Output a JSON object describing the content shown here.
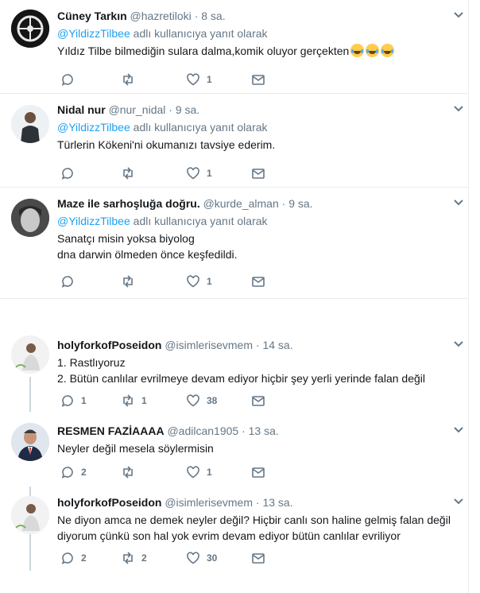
{
  "tweets": [
    {
      "name": "Cüney Tarkın",
      "handle": "@hazretiloki",
      "dot": "·",
      "time": "8 sa.",
      "reply_mention": "@YildizzTilbee",
      "reply_suffix": "adlı kullanıcıya yanıt olarak",
      "text": "Yıldız Tilbe bilmediğin sulara dalma,komik oluyor gerçekten",
      "emoji": [
        "face-with-tears-of-joy",
        "face-with-tears-of-joy",
        "face-with-tears-of-joy"
      ],
      "reply_count": "",
      "retweet_count": "",
      "like_count": "1"
    },
    {
      "name": "Nidal nur",
      "handle": "@nur_nidal",
      "dot": "·",
      "time": "9 sa.",
      "reply_mention": "@YildizzTilbee",
      "reply_suffix": "adlı kullanıcıya yanıt olarak",
      "text": "Türlerin Kökeni'ni okumanızı tavsiye ederim.",
      "reply_count": "",
      "retweet_count": "",
      "like_count": "1"
    },
    {
      "name": "Maze ile sarhoşluğa doğru.",
      "handle": "@kurde_alman",
      "dot": "·",
      "time": "9 sa.",
      "reply_mention": "@YildizzTilbee",
      "reply_suffix": "adlı kullanıcıya yanıt olarak",
      "text": "Sanatçı misin yoksa biyolog\ndna darwin  ölmeden önce keşfedildi.",
      "reply_count": "",
      "retweet_count": "",
      "like_count": "1"
    },
    {
      "name": "holyforkofPoseidon",
      "handle": "@isimlerisevmem",
      "dot": "·",
      "time": "14 sa.",
      "text": "1. Rastlıyoruz\n2. Bütün canlılar evrilmeye devam ediyor hiçbir şey yerli yerinde falan değil",
      "reply_count": "1",
      "retweet_count": "1",
      "like_count": "38"
    },
    {
      "name": "RESMEN FAZİAAAA",
      "handle": "@adilcan1905",
      "dot": "·",
      "time": "13 sa.",
      "text": "Neyler değil mesela söylermisin",
      "reply_count": "2",
      "retweet_count": "",
      "like_count": "1"
    },
    {
      "name": "holyforkofPoseidon",
      "handle": "@isimlerisevmem",
      "dot": "·",
      "time": "13 sa.",
      "text": "Ne diyon amca ne demek neyler değil? Hiçbir canlı son haline gelmiş falan değil diyorum çünkü son hal yok evrim devam ediyor bütün canlılar evriliyor",
      "reply_count": "2",
      "retweet_count": "2",
      "like_count": "30"
    }
  ],
  "icons": {
    "reply": "reply-icon",
    "retweet": "retweet-icon",
    "like": "heart-icon",
    "message": "direct-message-icon",
    "more": "chevron-down-icon"
  },
  "colors": {
    "link": "#1da1f2",
    "secondary_text": "#657786",
    "primary_text": "#14171a",
    "divider": "#e6ecf0",
    "thread_line": "#ccd6dd"
  }
}
